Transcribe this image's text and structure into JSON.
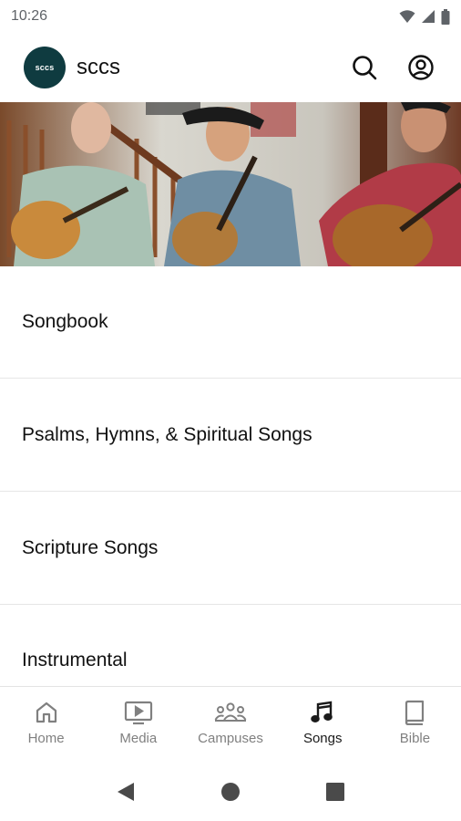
{
  "status_bar": {
    "time": "10:26"
  },
  "header": {
    "logo_text": "sccs",
    "title": "sccs",
    "search_icon": "search-icon",
    "account_icon": "account-circle-icon"
  },
  "banner": {
    "description_icon": "photo-banner"
  },
  "menu": [
    {
      "label": "Songbook"
    },
    {
      "label": "Psalms, Hymns, & Spiritual Songs"
    },
    {
      "label": "Scripture Songs"
    },
    {
      "label": "Instrumental"
    }
  ],
  "bottom_nav": [
    {
      "label": "Home",
      "icon": "home-icon",
      "active": false
    },
    {
      "label": "Media",
      "icon": "media-icon",
      "active": false
    },
    {
      "label": "Campuses",
      "icon": "campuses-icon",
      "active": false
    },
    {
      "label": "Songs",
      "icon": "music-note-icon",
      "active": true
    },
    {
      "label": "Bible",
      "icon": "book-icon",
      "active": false
    }
  ],
  "colors": {
    "logo_bg": "#0f3b40",
    "active_nav": "#1a1a1a",
    "inactive_nav": "#808080"
  }
}
